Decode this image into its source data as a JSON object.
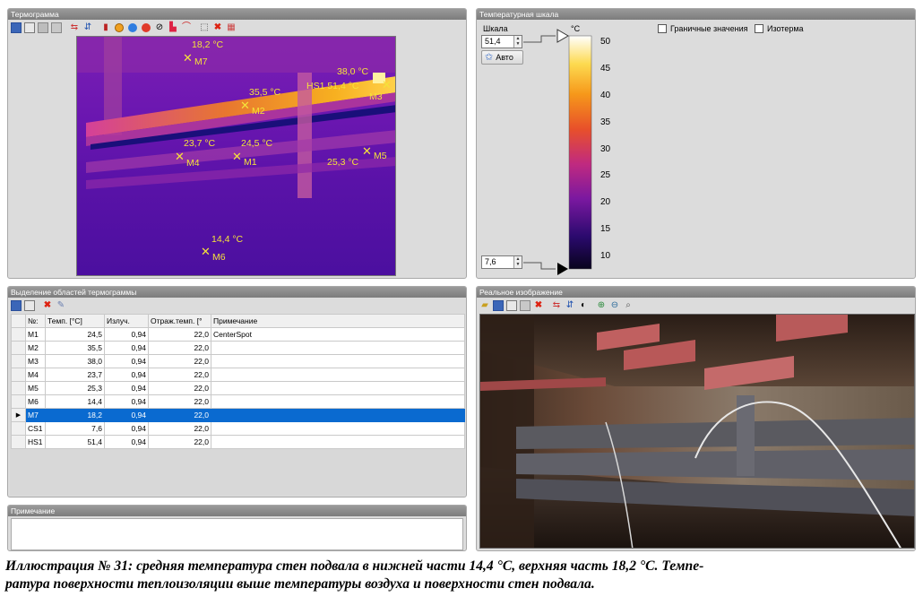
{
  "thermogram_panel": {
    "title": "Термограмма",
    "markers": [
      {
        "id": "M7",
        "temp": "18,2 °C"
      },
      {
        "id": "M2",
        "temp": "35,5 °C"
      },
      {
        "id": "M3",
        "temp": "38,0 °C"
      },
      {
        "id": "HS1",
        "temp": "HS1 51,4 °C"
      },
      {
        "id": "M4",
        "temp": "23,7 °C"
      },
      {
        "id": "M1",
        "temp": "24,5 °C"
      },
      {
        "id": "M5",
        "temp": "25,3 °C"
      },
      {
        "id": "M6",
        "temp": "14,4 °C"
      }
    ]
  },
  "scale_panel": {
    "title": "Температурная шкала",
    "scale_label": "Шкала",
    "max_value": "51,4",
    "min_value": "7,6",
    "auto_button": "Авто",
    "unit": "°C",
    "ticks": [
      "50",
      "45",
      "40",
      "35",
      "30",
      "25",
      "20",
      "15",
      "10"
    ],
    "checkbox_limits": "Граничные значения",
    "checkbox_isotherm": "Изотерма"
  },
  "regions_panel": {
    "title": "Выделение областей термограммы",
    "columns": [
      "№:",
      "Темп. [°C]",
      "Излуч.",
      "Отраж.темп. [°",
      "Примечание"
    ],
    "rows": [
      [
        "M1",
        "24,5",
        "0,94",
        "22,0",
        "CenterSpot"
      ],
      [
        "M2",
        "35,5",
        "0,94",
        "22,0",
        ""
      ],
      [
        "M3",
        "38,0",
        "0,94",
        "22,0",
        ""
      ],
      [
        "M4",
        "23,7",
        "0,94",
        "22,0",
        ""
      ],
      [
        "M5",
        "25,3",
        "0,94",
        "22,0",
        ""
      ],
      [
        "M6",
        "14,4",
        "0,94",
        "22,0",
        ""
      ],
      [
        "M7",
        "18,2",
        "0,94",
        "22,0",
        ""
      ],
      [
        "CS1",
        "7,6",
        "0,94",
        "22,0",
        ""
      ],
      [
        "HS1",
        "51,4",
        "0,94",
        "22,0",
        ""
      ]
    ],
    "selected_row": 6
  },
  "note_panel": {
    "title": "Примечание"
  },
  "real_image_panel": {
    "title": "Реальное изображение"
  },
  "caption": {
    "line1": "Иллюстрация № 31: средняя температура стен подвала в нижней части 14,4 °С, верхняя часть 18,2 °С. Темпе-",
    "line2": "ратура поверхности теплоизоляции выше температуры воздуха и поверхности стен подвала."
  },
  "colors": {
    "selection": "#0a6ad0",
    "marker": "#f5e23a",
    "panel_bg": "#dcdcdc"
  }
}
